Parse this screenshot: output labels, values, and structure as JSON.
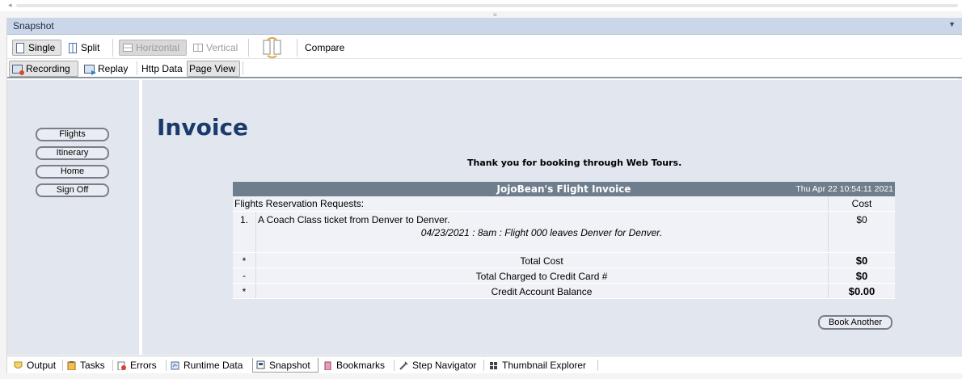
{
  "panel": {
    "title": "Snapshot"
  },
  "toolbar": {
    "single_label": "Single",
    "split_label": "Split",
    "horizontal_label": "Horizontal",
    "vertical_label": "Vertical",
    "compare_label": "Compare"
  },
  "subtoolbar": {
    "recording_label": "Recording",
    "replay_label": "Replay",
    "http_data_label": "Http Data",
    "page_view_label": "Page View"
  },
  "nav": {
    "items": [
      {
        "label": "Flights"
      },
      {
        "label": "Itinerary"
      },
      {
        "label": "Home"
      },
      {
        "label": "Sign Off"
      }
    ]
  },
  "page": {
    "title": "Invoice",
    "thanks": "Thank you for booking through Web Tours."
  },
  "invoice": {
    "title": "JojoBean's Flight Invoice",
    "date": "Thu Apr 22 10:54:11 2021",
    "section_label": "Flights Reservation Requests:",
    "cost_header": "Cost",
    "item_number": "1.",
    "item_description": "A Coach Class ticket from Denver to Denver.",
    "item_detail": "04/23/2021 : 8am : Flight 000 leaves Denver for Denver.",
    "item_cost": "$0",
    "totals": [
      {
        "marker": "*",
        "label": "Total Cost",
        "value": "$0"
      },
      {
        "marker": "-",
        "label": "Total Charged to Credit Card #",
        "value": "$0"
      },
      {
        "marker": "*",
        "label": "Credit Account Balance",
        "value": "$0.00"
      }
    ],
    "book_another_label": "Book Another"
  },
  "bottom_tabs": [
    {
      "label": "Output",
      "icon": "shield-icon"
    },
    {
      "label": "Tasks",
      "icon": "clipboard-icon"
    },
    {
      "label": "Errors",
      "icon": "error-list-icon"
    },
    {
      "label": "Runtime Data",
      "icon": "runtime-data-icon"
    },
    {
      "label": "Snapshot",
      "icon": "snapshot-icon"
    },
    {
      "label": "Bookmarks",
      "icon": "bookmark-icon"
    },
    {
      "label": "Step Navigator",
      "icon": "step-navigator-icon"
    },
    {
      "label": "Thumbnail Explorer",
      "icon": "thumbnail-explorer-icon"
    }
  ],
  "colors": {
    "panel_header": "#c9d7e8",
    "content_bg": "#e1e6ef",
    "invoice_header": "#6f7e8c",
    "title_blue": "#1a3a6b"
  }
}
